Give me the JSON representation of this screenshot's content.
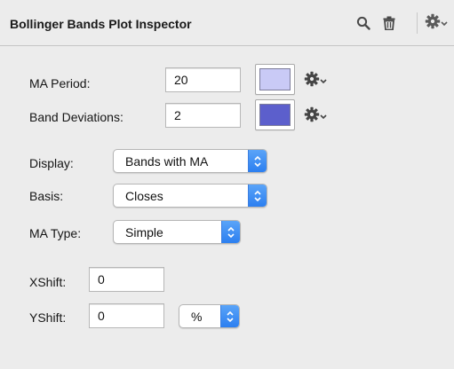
{
  "panel": {
    "title": "Bollinger Bands Plot Inspector",
    "icons": [
      "search-icon",
      "trash-icon",
      "gear-icon",
      "chevron-down-icon"
    ]
  },
  "ma_period": {
    "label": "MA Period:",
    "value": "20",
    "color": "#c9caf6"
  },
  "band_deviations": {
    "label": "Band Deviations:",
    "value": "2",
    "color": "#5c5fcc"
  },
  "display": {
    "label": "Display:",
    "value": "Bands with MA"
  },
  "basis": {
    "label": "Basis:",
    "value": "Closes"
  },
  "ma_type": {
    "label": "MA Type:",
    "value": "Simple"
  },
  "xshift": {
    "label": "XShift:",
    "value": "0"
  },
  "yshift": {
    "label": "YShift:",
    "value": "0",
    "unit": "%"
  },
  "colors": {
    "accent": "#2c7ff0",
    "background": "#ececec"
  }
}
